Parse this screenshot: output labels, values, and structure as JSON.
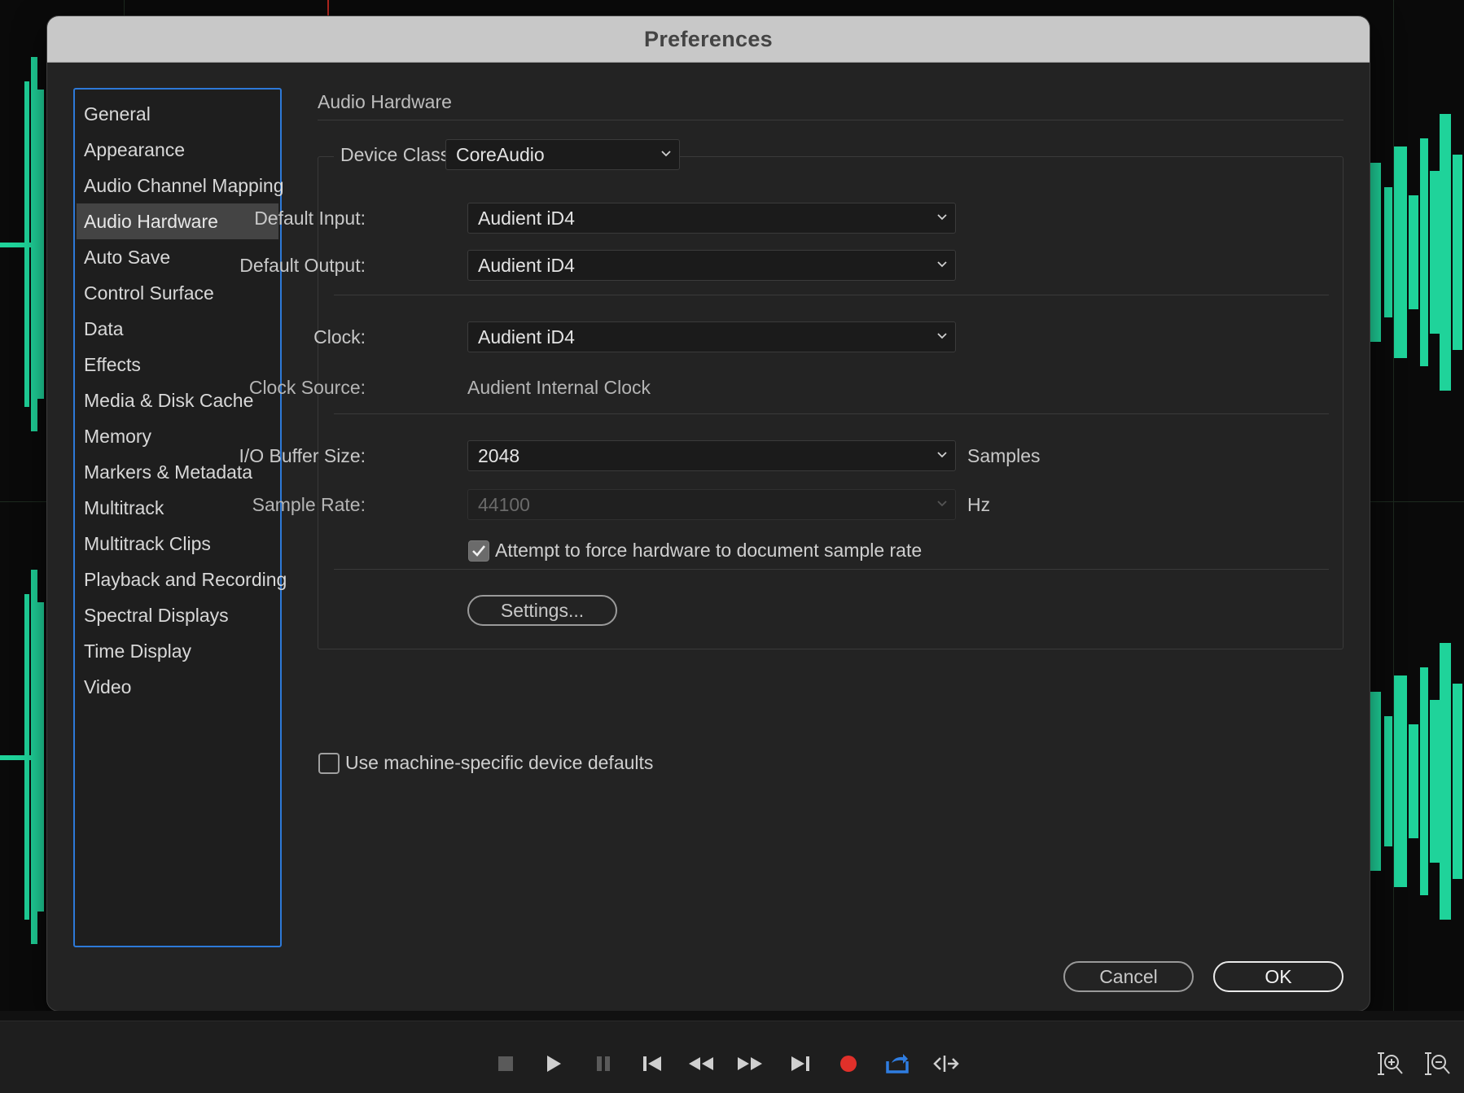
{
  "dialog": {
    "title": "Preferences"
  },
  "categories": [
    {
      "label": "General",
      "selected": false
    },
    {
      "label": "Appearance",
      "selected": false
    },
    {
      "label": "Audio Channel Mapping",
      "selected": false
    },
    {
      "label": "Audio Hardware",
      "selected": true
    },
    {
      "label": "Auto Save",
      "selected": false
    },
    {
      "label": "Control Surface",
      "selected": false
    },
    {
      "label": "Data",
      "selected": false
    },
    {
      "label": "Effects",
      "selected": false
    },
    {
      "label": "Media & Disk Cache",
      "selected": false
    },
    {
      "label": "Memory",
      "selected": false
    },
    {
      "label": "Markers & Metadata",
      "selected": false
    },
    {
      "label": "Multitrack",
      "selected": false
    },
    {
      "label": "Multitrack Clips",
      "selected": false
    },
    {
      "label": "Playback and Recording",
      "selected": false
    },
    {
      "label": "Spectral Displays",
      "selected": false
    },
    {
      "label": "Time Display",
      "selected": false
    },
    {
      "label": "Video",
      "selected": false
    }
  ],
  "audio_hardware": {
    "section_title": "Audio Hardware",
    "device_class_label": "Device Class:",
    "device_class_value": "CoreAudio",
    "default_input_label": "Default Input:",
    "default_input_value": "Audient iD4",
    "default_output_label": "Default Output:",
    "default_output_value": "Audient iD4",
    "clock_label": "Clock:",
    "clock_value": "Audient iD4",
    "clock_source_label": "Clock Source:",
    "clock_source_value": "Audient Internal Clock",
    "buffer_size_label": "I/O Buffer Size:",
    "buffer_size_value": "2048",
    "buffer_size_unit": "Samples",
    "sample_rate_label": "Sample Rate:",
    "sample_rate_value": "44100",
    "sample_rate_unit": "Hz",
    "force_rate_label": "Attempt to force hardware to document sample rate",
    "force_rate_checked": true,
    "settings_button": "Settings...",
    "machine_defaults_label": "Use machine-specific device defaults",
    "machine_defaults_checked": false
  },
  "footer": {
    "cancel_label": "Cancel",
    "ok_label": "OK"
  },
  "colors": {
    "accent_selection": "#2d79d8",
    "waveform": "#1fd39a",
    "record": "#e0302a",
    "loop": "#2f7de1"
  },
  "transport": {
    "icons": [
      "stop-icon",
      "play-icon",
      "pause-icon",
      "skip-to-start-icon",
      "rewind-icon",
      "fast-forward-icon",
      "skip-to-end-icon",
      "record-icon",
      "loop-icon",
      "skip-selection-icon"
    ],
    "zoom_icons": [
      "zoom-in-amplitude-icon",
      "zoom-out-amplitude-icon"
    ]
  }
}
